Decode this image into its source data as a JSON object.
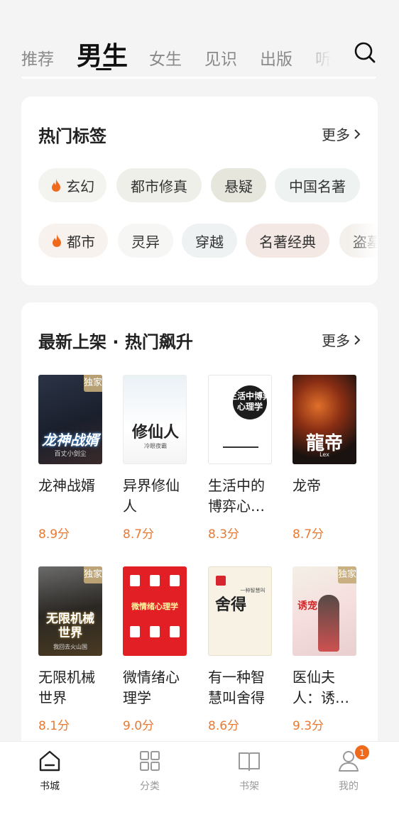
{
  "tabs": [
    {
      "label": "推荐",
      "active": false
    },
    {
      "label": "男生",
      "active": true
    },
    {
      "label": "女生",
      "active": false
    },
    {
      "label": "见识",
      "active": false
    },
    {
      "label": "出版",
      "active": false
    },
    {
      "label": "听",
      "active": false
    }
  ],
  "search_icon": "search-icon",
  "hot_tags": {
    "title": "热门标签",
    "more": "更多",
    "row1": [
      {
        "label": "玄幻",
        "hot": true
      },
      {
        "label": "都市修真",
        "hot": false
      },
      {
        "label": "悬疑",
        "hot": false
      },
      {
        "label": "中国名著",
        "hot": false
      }
    ],
    "row2": [
      {
        "label": "都市",
        "hot": true
      },
      {
        "label": "灵异",
        "hot": false
      },
      {
        "label": "穿越",
        "hot": false
      },
      {
        "label": "名著经典",
        "hot": false
      },
      {
        "label": "盗墓",
        "hot": false
      }
    ]
  },
  "new_books": {
    "title": "最新上架 · 热门飙升",
    "more": "更多",
    "exclusive_label": "独家",
    "books": [
      {
        "title": "龙神战婿",
        "score": "8.9分",
        "exclusive": true,
        "cover_text": "龙神战婿",
        "cover_sub": "百丈小剑尘"
      },
      {
        "title": "异界修仙人",
        "score": "8.7分",
        "exclusive": false,
        "cover_text": "修仙人",
        "cover_sub": "冷眼夜霸"
      },
      {
        "title": "生活中的博弈心理学",
        "score": "8.3分",
        "exclusive": false,
        "cover_text": "生活中博弈心理学",
        "cover_sub": ""
      },
      {
        "title": "龙帝",
        "score": "8.7分",
        "exclusive": false,
        "cover_text": "龍帝",
        "cover_sub": "Lex"
      },
      {
        "title": "无限机械世界",
        "score": "8.1分",
        "exclusive": true,
        "cover_text": "无限机械世界",
        "cover_sub": "我回去火山国"
      },
      {
        "title": "微情绪心理学",
        "score": "9.0分",
        "exclusive": false,
        "cover_text": "微情绪心理学",
        "cover_sub": ""
      },
      {
        "title": "有一种智慧叫舍得",
        "score": "8.6分",
        "exclusive": false,
        "cover_text": "舍得",
        "cover_sub": "一种智慧叫"
      },
      {
        "title": "医仙夫人：诱宠小娇妻",
        "score": "9.3分",
        "exclusive": true,
        "cover_text": "诱宠",
        "cover_sub": ""
      }
    ]
  },
  "bottom_nav": [
    {
      "label": "书城",
      "icon": "home-icon",
      "active": true
    },
    {
      "label": "分类",
      "icon": "grid-icon",
      "active": false
    },
    {
      "label": "书架",
      "icon": "book-icon",
      "active": false
    },
    {
      "label": "我的",
      "icon": "user-icon",
      "active": false,
      "badge": "1"
    }
  ],
  "colors": {
    "accent": "#e87a33",
    "flame": "#f06a1e",
    "badge": "#f06a1e"
  }
}
